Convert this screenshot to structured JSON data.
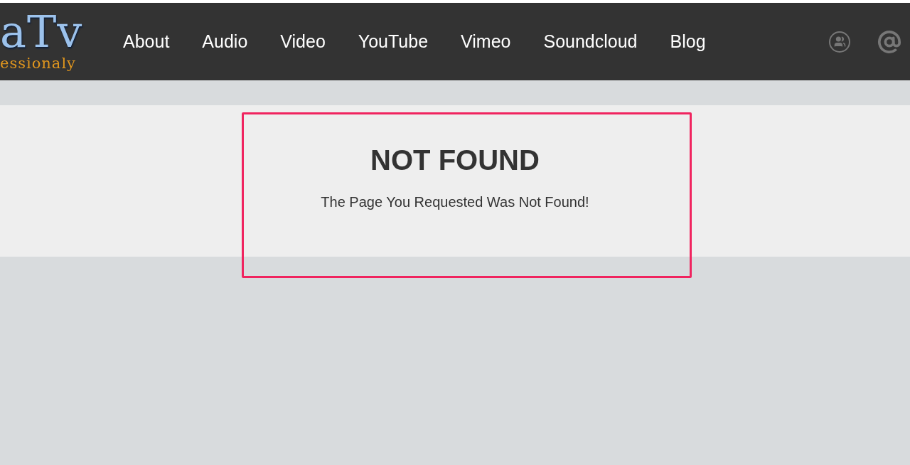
{
  "header": {
    "logo": {
      "title": "aTv",
      "tagline": "essionaly"
    },
    "nav": [
      {
        "label": "About"
      },
      {
        "label": "Audio"
      },
      {
        "label": "Video"
      },
      {
        "label": "YouTube"
      },
      {
        "label": "Vimeo"
      },
      {
        "label": "Soundcloud"
      },
      {
        "label": "Blog"
      }
    ]
  },
  "content": {
    "title": "NOT FOUND",
    "message": "The Page You Requested Was Not Found!",
    "highlighted": true
  }
}
